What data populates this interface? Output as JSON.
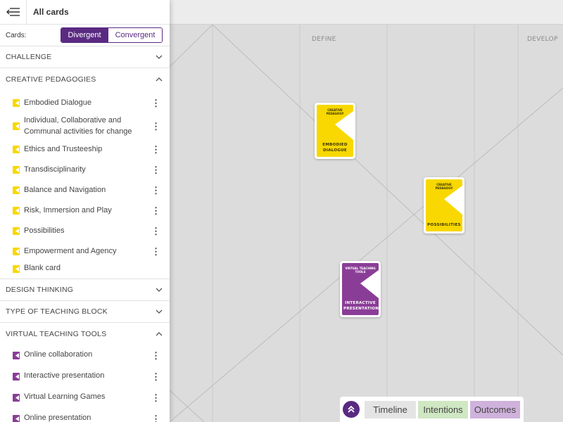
{
  "sidebar": {
    "title": "All cards",
    "cards_label": "Cards:",
    "toggle": {
      "active": "Divergent",
      "inactive": "Convergent"
    },
    "sections": [
      {
        "label": "CHALLENGE",
        "expanded": false
      },
      {
        "label": "CREATIVE PEDAGOGIES",
        "expanded": true
      },
      {
        "label": "DESIGN THINKING",
        "expanded": false
      },
      {
        "label": "TYPE OF TEACHING BLOCK",
        "expanded": false
      },
      {
        "label": "VIRTUAL TEACHING TOOLS",
        "expanded": true
      }
    ],
    "creative_items": [
      "Embodied Dialogue",
      "Individual, Collaborative and Communal activities for change",
      "Ethics and Trusteeship",
      "Transdisciplinarity",
      "Balance and Navigation",
      "Risk, Immersion and Play",
      "Possibilities",
      "Empowerment and Agency",
      "Blank card"
    ],
    "virtual_items": [
      "Online collaboration",
      "Interactive presentation",
      "Virtual Learning Games",
      "Online presentation"
    ]
  },
  "canvas": {
    "column_labels": [
      "DEFINE",
      "DEVELOP"
    ],
    "cards": [
      {
        "tag": "CREATIVE PEDAGOGY",
        "title": "EMBODIED DIALOGUE",
        "color": "#f8d800"
      },
      {
        "tag": "CREATIVE PEDAGOGY",
        "title": "POSSIBILITIES",
        "color": "#f8d800"
      },
      {
        "tag": "VIRTUAL TEACHING TOOLS",
        "title": "INTERACTIVE PRESENTATION",
        "color": "#8a3d97"
      }
    ]
  },
  "bottom_bar": {
    "tabs": [
      "Timeline",
      "Intentions",
      "Outcomes"
    ]
  },
  "colors": {
    "accent": "#5a2a82",
    "card_yellow": "#f8d800",
    "card_purple": "#8a3d97",
    "intentions": "#cfe7c2",
    "outcomes": "#cfb2dc"
  },
  "icons": {
    "menu": "menu-collapse-icon",
    "chevron_down": "chevron-down-icon",
    "chevron_up": "chevron-up-icon",
    "kebab": "kebab-menu-icon",
    "card": "card-icon",
    "double_up": "double-chevron-up-icon"
  }
}
